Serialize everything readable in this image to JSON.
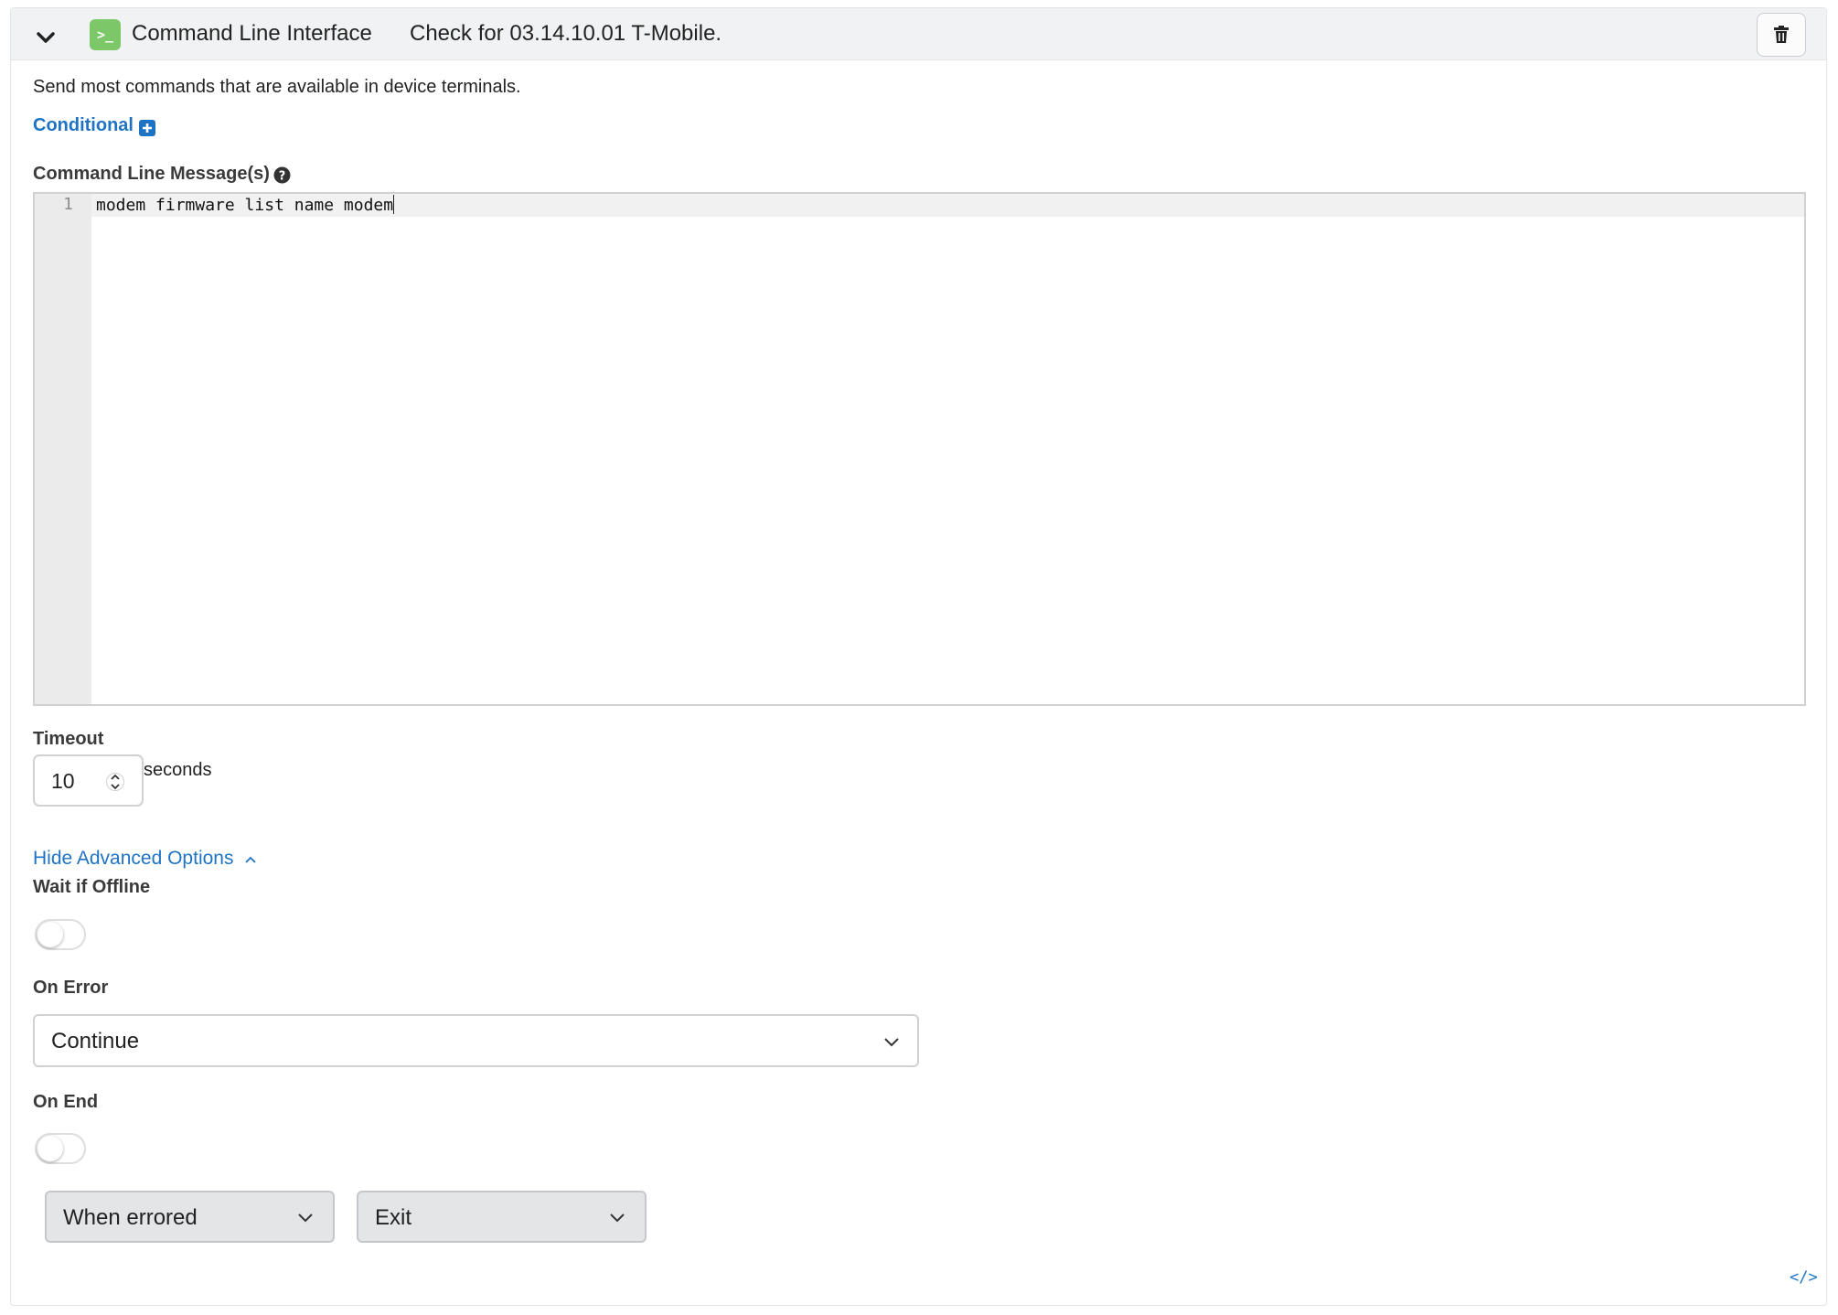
{
  "header": {
    "title": "Command Line Interface",
    "subtitle": "Check for 03.14.10.01 T-Mobile.",
    "icon_glyph": ">_",
    "icon_color": "#7cc768"
  },
  "description": "Send most commands that are available in device terminals.",
  "conditional": {
    "label": "Conditional"
  },
  "messages": {
    "label": "Command Line Message(s)",
    "lines": [
      {
        "number": "1",
        "text": "modem firmware list name modem"
      }
    ]
  },
  "timeout": {
    "label": "Timeout",
    "value": "10",
    "unit": "seconds"
  },
  "advanced_link": "Hide Advanced Options",
  "wait_if_offline": {
    "label": "Wait if Offline",
    "enabled": false
  },
  "on_error": {
    "label": "On Error",
    "selected": "Continue"
  },
  "on_end": {
    "label": "On End",
    "enabled": false,
    "condition_selected": "When errored",
    "action_selected": "Exit"
  },
  "code_toggle_glyph": "</>",
  "colors": {
    "link": "#1f73c4",
    "header_bg": "#f1f2f3"
  }
}
